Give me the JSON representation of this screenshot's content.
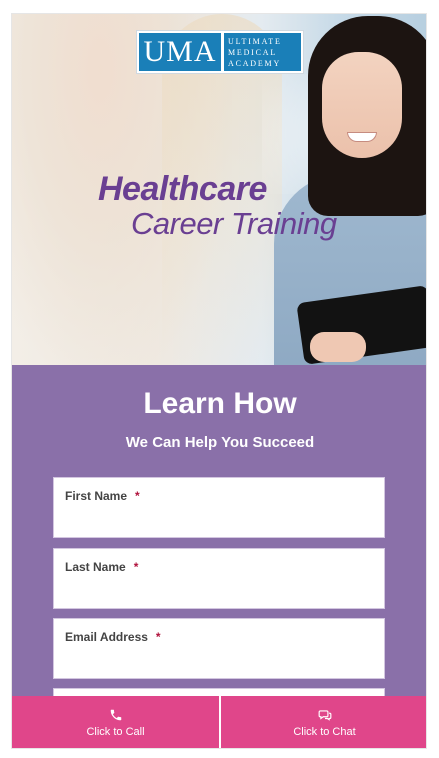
{
  "brand": {
    "logo_mark": "UMA",
    "logo_words": [
      "ULTIMATE",
      "MEDICAL",
      "ACADEMY"
    ]
  },
  "hero": {
    "headline": "Healthcare",
    "subline": "Career Training"
  },
  "form": {
    "title": "Learn How",
    "subtitle": "We Can Help You Succeed",
    "required_mark": "*",
    "fields": [
      {
        "label": "First Name",
        "value": ""
      },
      {
        "label": "Last Name",
        "value": ""
      },
      {
        "label": "Email Address",
        "value": ""
      }
    ]
  },
  "bottom_bar": {
    "call_label": "Click to Call",
    "chat_label": "Click to Chat",
    "call_icon": "phone-icon",
    "chat_icon": "chat-bubbles-icon"
  },
  "colors": {
    "panel": "#8a70a9",
    "cta": "#e0468a",
    "headline": "#6a3f92",
    "logo_blue": "#1a7fb8"
  }
}
